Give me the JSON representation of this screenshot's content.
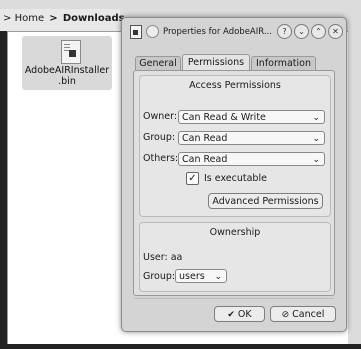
{
  "file_manager": {
    "breadcrumb": {
      "arrow": ">",
      "home": "Home",
      "separator": ">",
      "current": "Downloads"
    },
    "file": {
      "name_line1": "AdobeAIRInstaller",
      "name_line2": ".bin",
      "icon": "binary-file-icon"
    }
  },
  "dialog": {
    "title": "Properties for AdobeAIR...",
    "titlebar_buttons": {
      "help": "?",
      "minimize": "⌄",
      "maximize": "⌃",
      "close": "✕"
    },
    "tabs": [
      "General",
      "Permissions",
      "Information"
    ],
    "active_tab": "Permissions",
    "access": {
      "title": "Access Permissions",
      "owner_label": "Owner:",
      "owner_value": "Can Read & Write",
      "group_label": "Group:",
      "group_value": "Can Read",
      "others_label": "Others:",
      "others_value": "Can Read",
      "executable_label": "Is executable",
      "executable_checked": true,
      "advanced_button": "Advanced Permissions"
    },
    "ownership": {
      "title": "Ownership",
      "user_text": "User: aa",
      "group_label": "Group:",
      "group_value": "users"
    },
    "buttons": {
      "ok": "OK",
      "cancel": "Cancel"
    },
    "colors": {
      "dialog_bg": "#d4d4d4",
      "panel_bg": "#e0e0e0"
    }
  }
}
